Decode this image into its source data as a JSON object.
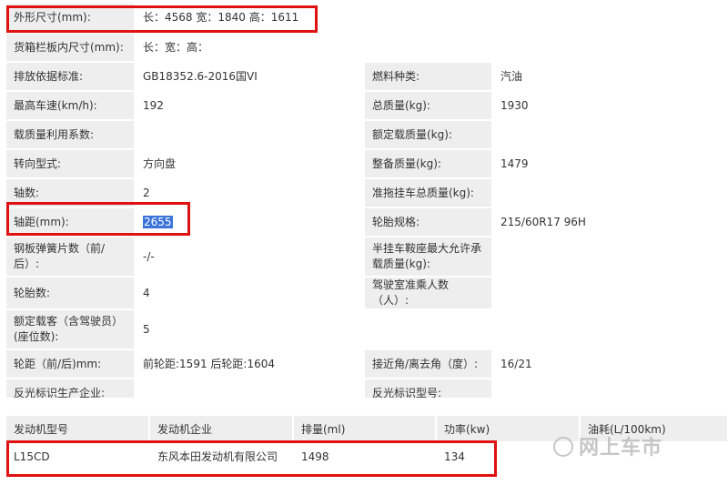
{
  "spec_rows": [
    {
      "l1": "外形尺寸(mm):",
      "v1": "长：4568 宽：1840 高：1611",
      "full": true
    },
    {
      "l1": "货箱栏板内尺寸(mm):",
      "v1": "长：宽：高：",
      "full": true
    },
    {
      "l1": "排放依据标准:",
      "v1": "GB18352.6-2016国VI",
      "l2": "燃料种类:",
      "v2": "汽油"
    },
    {
      "l1": "最高车速(km/h):",
      "v1": "192",
      "l2": "总质量(kg):",
      "v2": "1930"
    },
    {
      "l1": "载质量利用系数:",
      "v1": "",
      "l2": "额定载质量(kg):",
      "v2": ""
    },
    {
      "l1": "转向型式:",
      "v1": "方向盘",
      "l2": "整备质量(kg):",
      "v2": "1479"
    },
    {
      "l1": "轴数:",
      "v1": "2",
      "l2": "准拖挂车总质量(kg):",
      "v2": ""
    },
    {
      "l1": "轴距(mm):",
      "v1": "2655",
      "l2": "轮胎规格:",
      "v2": "215/60R17 96H"
    },
    {
      "l1": "钢板弹簧片数（前/后）:",
      "v1": "-/-",
      "l2": "半挂车鞍座最大允许承载质量(kg):",
      "v2": ""
    },
    {
      "l1": "轮胎数:",
      "v1": "4",
      "l2": "驾驶室准乘人数（人）:",
      "v2": ""
    },
    {
      "l1": "额定载客（含驾驶员）(座位数):",
      "v1": "5",
      "full": true
    },
    {
      "l1": "轮距（前/后)mm:",
      "v1": "前轮距:1591 后轮距:1604",
      "l2": "接近角/离去角（度）:",
      "v2": "16/21"
    },
    {
      "l1": "反光标识生产企业:",
      "v1": "",
      "l2": "反光标识型号:",
      "v2": ""
    }
  ],
  "engine": {
    "headers": [
      "发动机型号",
      "发动机企业",
      "排量(ml)",
      "功率(kw)",
      "油耗(L/100km)"
    ],
    "row": [
      "L15CD",
      "东风本田发动机有限公司",
      "1498",
      "134",
      ""
    ]
  },
  "watermark": "网上车市",
  "colors": {
    "highlight": "#e01010",
    "selection": "#3a74d9",
    "label_bg": "#eeeeee"
  }
}
